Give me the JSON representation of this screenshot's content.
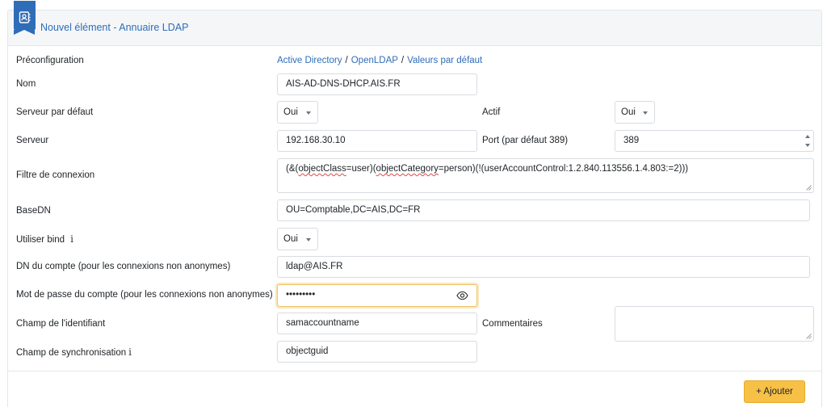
{
  "header": {
    "title": "Nouvel élément - Annuaire LDAP",
    "icon": "address-book-icon",
    "accent": "#2f6db8"
  },
  "form": {
    "preconfig": {
      "label": "Préconfiguration",
      "links": [
        "Active Directory",
        "OpenLDAP",
        "Valeurs par défaut"
      ],
      "separator": "/"
    },
    "name": {
      "label": "Nom",
      "value": "AIS-AD-DNS-DHCP.AIS.FR"
    },
    "default_server": {
      "label": "Serveur par défaut",
      "value": "Oui"
    },
    "active": {
      "label": "Actif",
      "value": "Oui"
    },
    "server": {
      "label": "Serveur",
      "value": "192.168.30.10"
    },
    "port": {
      "label": "Port (par défaut 389)",
      "value": "389"
    },
    "filter": {
      "label": "Filtre de connexion",
      "value_parts": [
        "(&(",
        "objectClass",
        "=user)(",
        "objectCategory",
        "=person)(!(userAccountControl:1.2.840.113556.1.4.803:=2)))"
      ]
    },
    "basedn": {
      "label": "BaseDN",
      "value": "OU=Comptable,DC=AIS,DC=FR"
    },
    "use_bind": {
      "label": "Utiliser bind",
      "value": "Oui",
      "info_icon": "info-icon"
    },
    "account_dn": {
      "label": "DN du compte (pour les connexions non anonymes)",
      "value": "ldap@AIS.FR"
    },
    "password": {
      "label": "Mot de passe du compte (pour les connexions non anonymes)",
      "value": "•••••••••",
      "toggle_icon": "eye-icon"
    },
    "login_field": {
      "label": "Champ de l'identifiant",
      "value": "samaccountname"
    },
    "comments": {
      "label": "Commentaires",
      "value": ""
    },
    "sync_field": {
      "label": "Champ de synchronisation",
      "value": "objectguid",
      "info_icon": "info-icon"
    }
  },
  "footer": {
    "add_button": {
      "icon": "plus-icon",
      "label": "+ Ajouter",
      "color": "#f7c046"
    }
  }
}
